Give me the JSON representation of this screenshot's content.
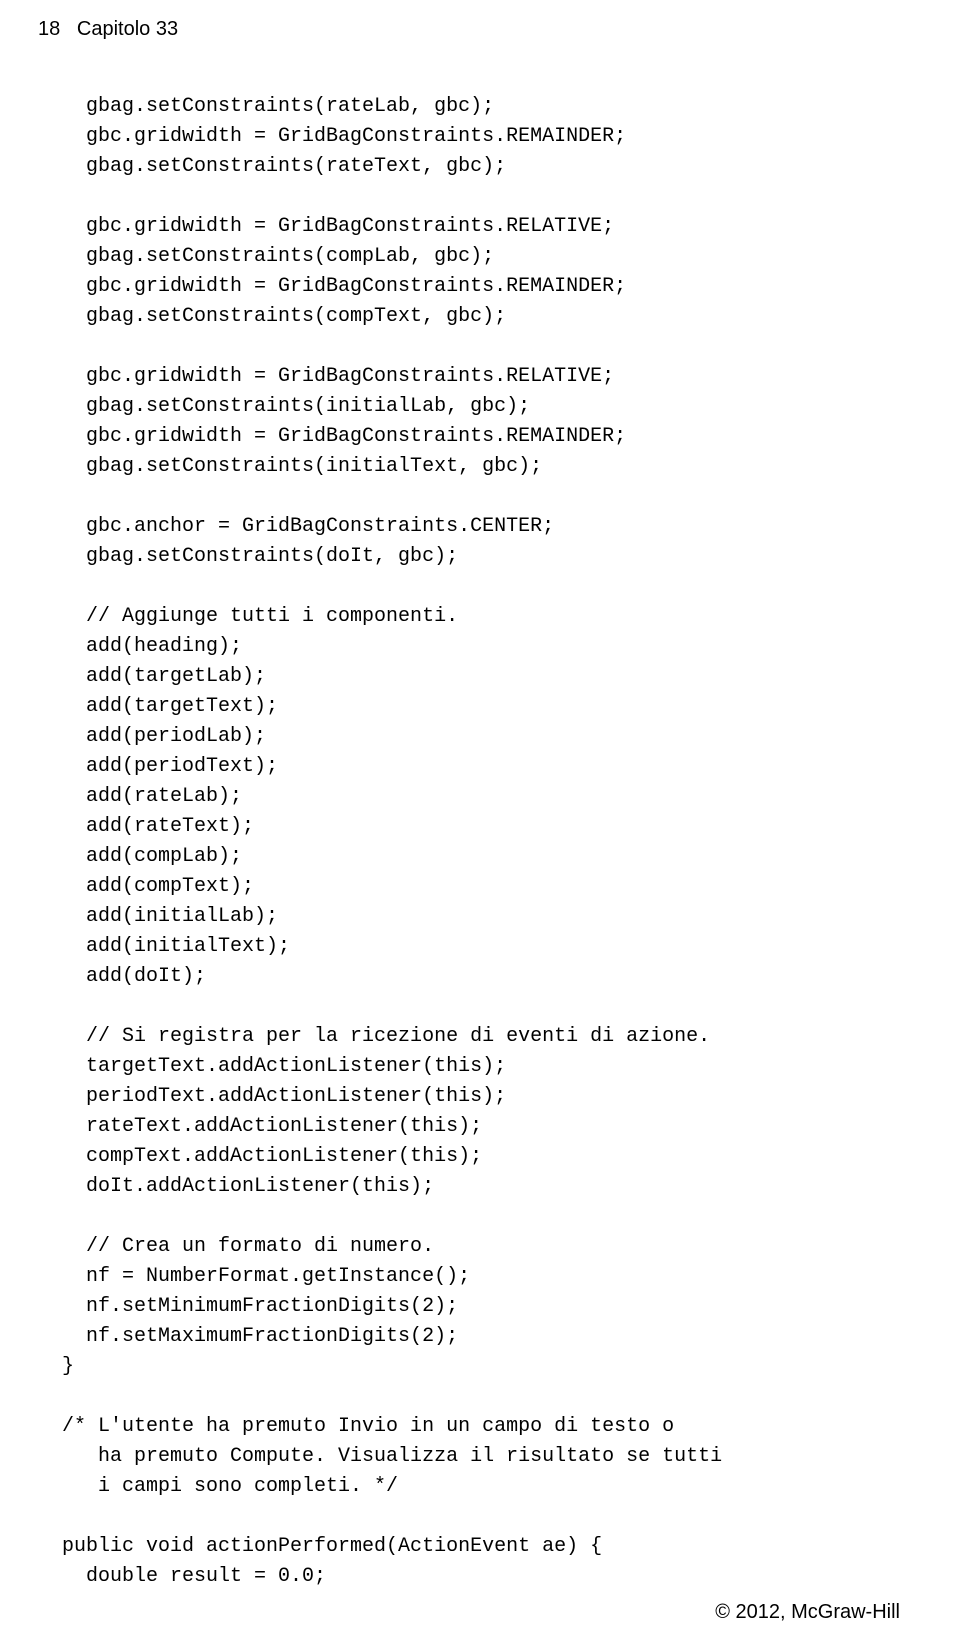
{
  "header": {
    "page_number": "18",
    "chapter": "Capitolo 33"
  },
  "code": "    gbag.setConstraints(rateLab, gbc);\n    gbc.gridwidth = GridBagConstraints.REMAINDER;\n    gbag.setConstraints(rateText, gbc);\n\n    gbc.gridwidth = GridBagConstraints.RELATIVE;\n    gbag.setConstraints(compLab, gbc);\n    gbc.gridwidth = GridBagConstraints.REMAINDER;\n    gbag.setConstraints(compText, gbc);\n\n    gbc.gridwidth = GridBagConstraints.RELATIVE;\n    gbag.setConstraints(initialLab, gbc);\n    gbc.gridwidth = GridBagConstraints.REMAINDER;\n    gbag.setConstraints(initialText, gbc);\n\n    gbc.anchor = GridBagConstraints.CENTER;\n    gbag.setConstraints(doIt, gbc);\n\n    // Aggiunge tutti i componenti.\n    add(heading);\n    add(targetLab);\n    add(targetText);\n    add(periodLab);\n    add(periodText);\n    add(rateLab);\n    add(rateText);\n    add(compLab);\n    add(compText);\n    add(initialLab);\n    add(initialText);\n    add(doIt);\n\n    // Si registra per la ricezione di eventi di azione.\n    targetText.addActionListener(this);\n    periodText.addActionListener(this);\n    rateText.addActionListener(this);\n    compText.addActionListener(this);\n    doIt.addActionListener(this);\n\n    // Crea un formato di numero.\n    nf = NumberFormat.getInstance();\n    nf.setMinimumFractionDigits(2);\n    nf.setMaximumFractionDigits(2);\n  }\n\n  /* L'utente ha premuto Invio in un campo di testo o\n     ha premuto Compute. Visualizza il risultato se tutti\n     i campi sono completi. */\n\n  public void actionPerformed(ActionEvent ae) {\n    double result = 0.0;",
  "footer": {
    "copyright": "© 2012, McGraw-Hill"
  }
}
